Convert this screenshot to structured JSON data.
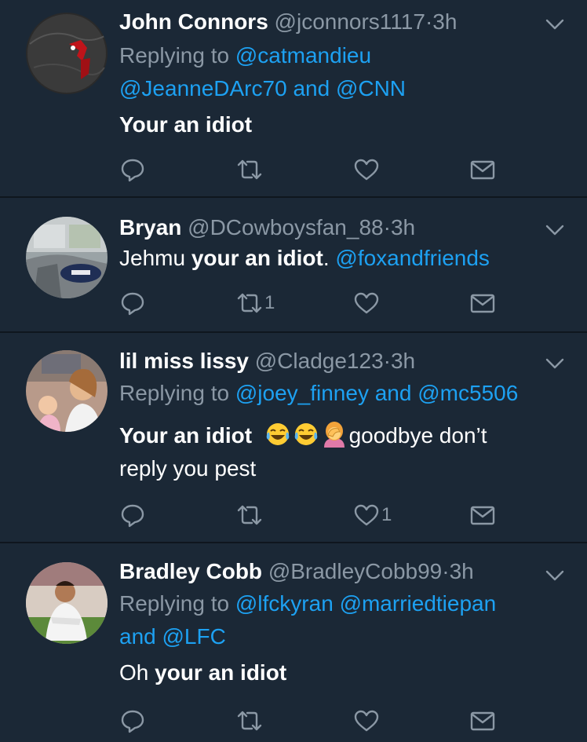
{
  "tweets": [
    {
      "name": "John Connors",
      "handle": "@jconnors1117",
      "dot": "·",
      "time": "3h",
      "replying_prefix": "Replying to",
      "mentions_line1": "@catmandieu",
      "mentions_line2a": "@JeanneDArc70",
      "and": "and",
      "mentions_line2b": "@CNN",
      "text": "Your an idiot",
      "retweet_count": "",
      "like_count": ""
    },
    {
      "name": "Bryan",
      "handle": "@DCowboysfan_88",
      "dot": "·",
      "time": "3h",
      "text_pre": "Jehmu",
      "text_bold": "your an idiot",
      "text_post": ".",
      "text_mention": "@foxandfriends",
      "retweet_count": "1",
      "like_count": ""
    },
    {
      "name": "lil miss lissy",
      "handle": "@Cladge123",
      "dot": "·",
      "time": "3h",
      "replying_prefix": "Replying to",
      "mention_a": "@joey_finney",
      "and": "and",
      "mention_b": "@mc5506",
      "text_bold": "Your an idiot",
      "text_after": "goodbye don’t",
      "text_line2": "reply you pest",
      "emojis": [
        "tears-of-joy-emoji",
        "tears-of-joy-emoji",
        "facepalm-emoji"
      ],
      "retweet_count": "",
      "like_count": "1"
    },
    {
      "name": "Bradley Cobb",
      "handle": "@BradleyCobb99",
      "dot": "·",
      "time": "3h",
      "replying_prefix": "Replying to",
      "mention_a": "@lfckyran",
      "mention_b": "@marriedtiepan",
      "and": "and",
      "mention_c": "@LFC",
      "text_pre": "Oh",
      "text_bold": "your an idiot",
      "retweet_count": "",
      "like_count": ""
    }
  ],
  "colors": {
    "background": "#1b2836",
    "divider": "#0f161e",
    "secondary_text": "#8b98a5",
    "link": "#1da1f2"
  },
  "icons": [
    "reply-icon",
    "retweet-icon",
    "like-icon",
    "direct-message-icon",
    "chevron-down-icon"
  ]
}
